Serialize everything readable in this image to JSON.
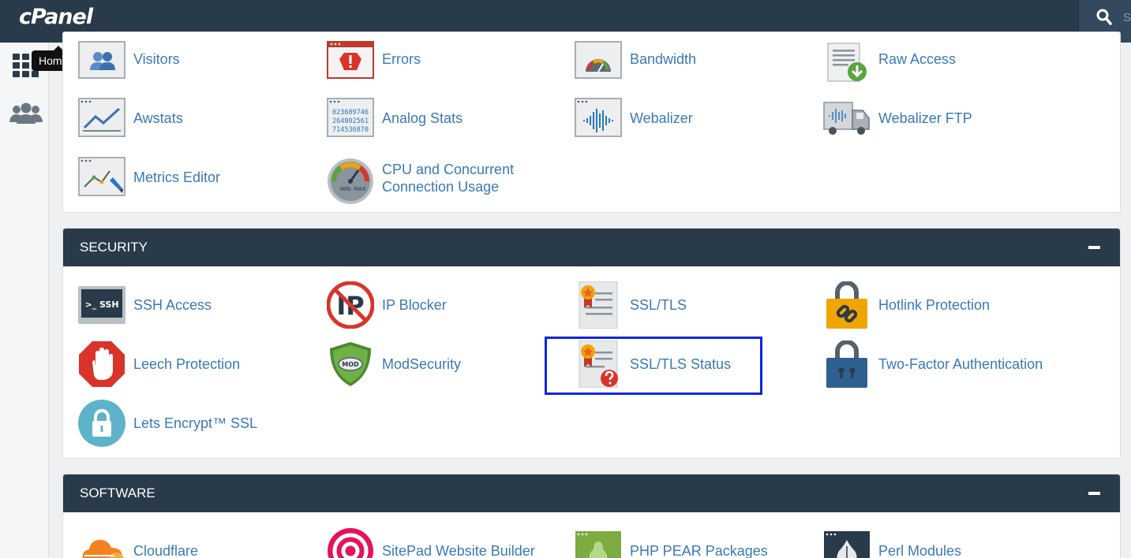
{
  "app": {
    "logo": "cPanel"
  },
  "search": {
    "placeholder_fragment": "Se"
  },
  "sidebar": {
    "tooltip": "Home"
  },
  "metrics": {
    "items": [
      {
        "label": "Visitors"
      },
      {
        "label": "Errors"
      },
      {
        "label": "Bandwidth"
      },
      {
        "label": "Raw Access"
      },
      {
        "label": "Awstats"
      },
      {
        "label": "Analog Stats"
      },
      {
        "label": "Webalizer"
      },
      {
        "label": "Webalizer FTP"
      },
      {
        "label": "Metrics Editor"
      },
      {
        "label_line1": "CPU and Concurrent",
        "label_line2": "Connection Usage"
      }
    ],
    "analog_digits": [
      "023689746",
      "264802561",
      "714536870"
    ]
  },
  "security": {
    "title": "SECURITY",
    "items": [
      {
        "label": "SSH Access"
      },
      {
        "label": "IP Blocker"
      },
      {
        "label": "SSL/TLS"
      },
      {
        "label": "Hotlink Protection"
      },
      {
        "label": "Leech Protection"
      },
      {
        "label": "ModSecurity"
      },
      {
        "label": "SSL/TLS Status"
      },
      {
        "label": "Two-Factor Authentication"
      },
      {
        "label": "Lets Encrypt™ SSL"
      }
    ],
    "icon_text": {
      "ssh": ">_ SSH",
      "ip": "IP",
      "mod": "MOD"
    }
  },
  "software": {
    "title": "SOFTWARE",
    "items": [
      {
        "label": "Cloudflare"
      },
      {
        "label": "SitePad Website Builder"
      },
      {
        "label": "PHP PEAR Packages"
      },
      {
        "label": "Perl Modules"
      }
    ]
  },
  "gauge_text": {
    "min": "MIN",
    "max": "MAX"
  },
  "colors": {
    "brand_dark": "#293a4a",
    "link": "#3a79b6",
    "highlight": "#0a26e0"
  }
}
